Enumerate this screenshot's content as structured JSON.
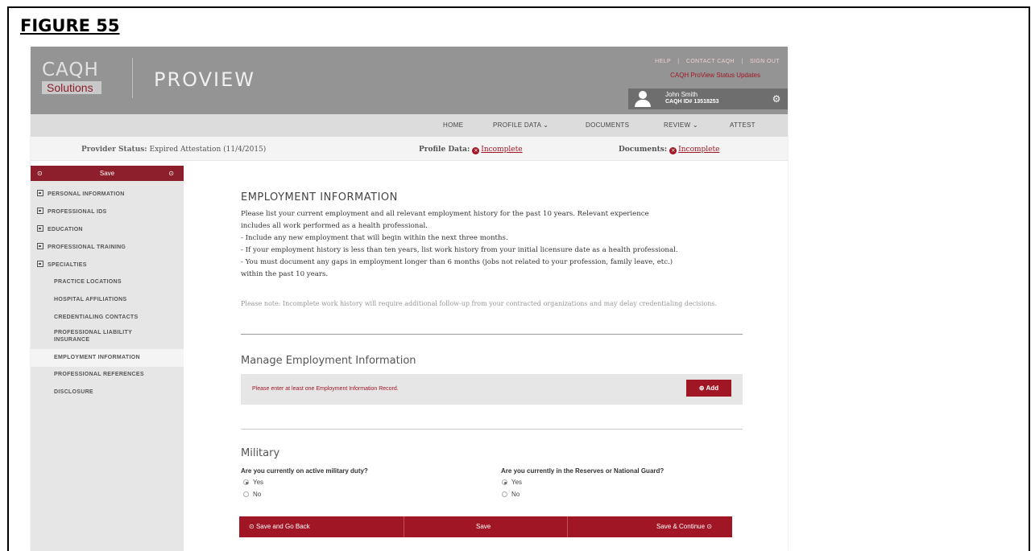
{
  "figure_label": "FIGURE 55",
  "header": {
    "logo_main": "CAQH",
    "logo_sub": "Solutions",
    "product": "PROVIEW",
    "top_links": [
      "HELP",
      "|",
      "CONTACT CAQH",
      "|",
      "SIGN OUT"
    ],
    "status_updates": "CAQH ProView Status Updates",
    "user_name": "John Smith",
    "user_id": "CAQH ID# 13518253",
    "settings_icon": "gear-icon"
  },
  "nav": {
    "home": "HOME",
    "profile_data": "PROFILE DATA ⌄",
    "documents": "DOCUMENTS",
    "review": "REVIEW ⌄",
    "attest": "ATTEST"
  },
  "status": {
    "provider_label": "Provider Status:",
    "provider_value": "Expired Attestation (11/4/2015)",
    "profile_label": "Profile Data:",
    "profile_value": "Incomplete",
    "documents_label": "Documents:",
    "documents_value": "Incomplete"
  },
  "sidebar": {
    "save_label": "Save",
    "items": [
      "PERSONAL INFORMATION",
      "PROFESSIONAL IDS",
      "EDUCATION",
      "PROFESSIONAL TRAINING",
      "SPECIALTIES",
      "PRACTICE LOCATIONS",
      "HOSPITAL AFFILIATIONS",
      "CREDENTIALING CONTACTS",
      "PROFESSIONAL LIABILITY",
      "INSURANCE",
      "EMPLOYMENT INFORMATION",
      "PROFESSIONAL REFERENCES",
      "DISCLOSURE"
    ]
  },
  "main": {
    "title": "EMPLOYMENT INFORMATION",
    "lines": [
      "Please list your current employment and all relevant employment history for the past 10 years. Relevant experience",
      "includes all work performed as a health professional.",
      "- Include any new employment that will begin within the next three months.",
      "- If your employment history is less than ten years, list work history from your initial licensure date as a health professional.",
      "- You must document any gaps in employment longer than 6 months (jobs not related to your profession, family leave, etc.)",
      "within the past 10 years."
    ],
    "note": "Please note: Incomplete work history will require additional follow-up from your contracted organizations and may delay credentialing decisions.",
    "manage_title": "Manage Employment Information",
    "warning": "Please enter at least one Employment Information Record.",
    "add_label": "Add",
    "military_title": "Military",
    "q1": "Are you currently on active military duty?",
    "q2": "Are you currently in the Reserves or National Guard?",
    "yes": "Yes",
    "no": "No"
  },
  "footer": {
    "back": "Save and Go Back",
    "save": "Save",
    "continue": "Save & Continue"
  }
}
